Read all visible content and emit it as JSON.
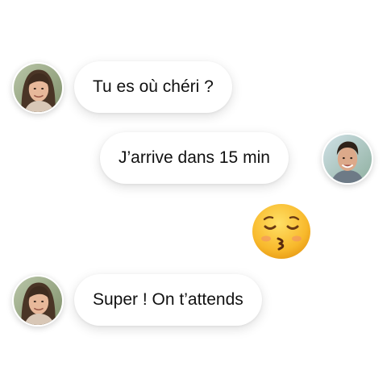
{
  "conversation": {
    "messages": [
      {
        "sender": "woman",
        "side": "left",
        "type": "text",
        "text": "Tu es où chéri ?"
      },
      {
        "sender": "man",
        "side": "right",
        "type": "text",
        "text": "J’arrive dans 15 min"
      },
      {
        "sender": "man",
        "side": "right",
        "type": "emoji",
        "emoji": "kissing-face-with-closed-eyes"
      },
      {
        "sender": "woman",
        "side": "left",
        "type": "text",
        "text": "Super ! On t’attends"
      }
    ]
  },
  "colors": {
    "background": "#ffffff",
    "bubble": "#ffffff",
    "text": "#111111",
    "emoji_face": "#f8b92c"
  }
}
